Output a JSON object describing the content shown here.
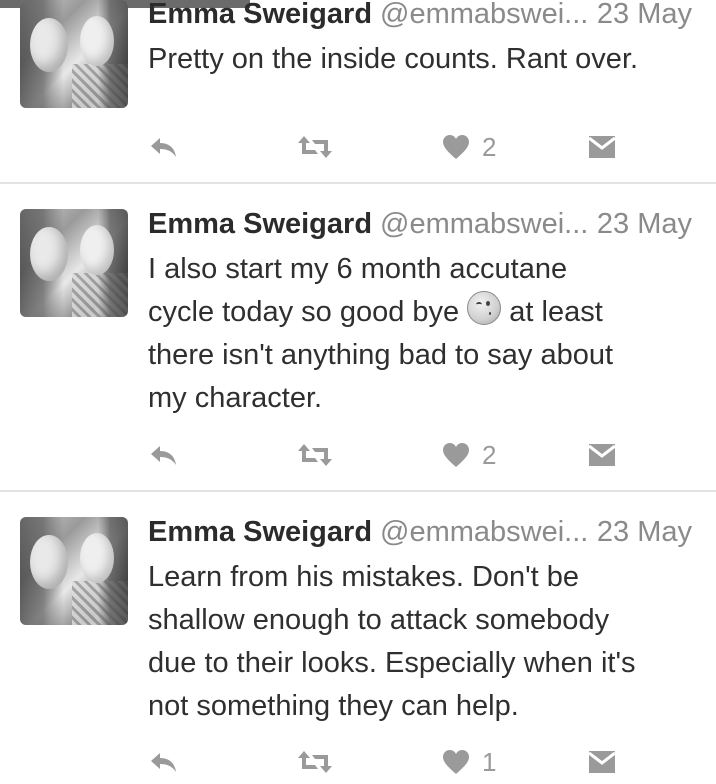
{
  "tweets": [
    {
      "name": "Emma Sweigard",
      "handle": "@emmabswei...",
      "date": "23 May",
      "lines": [
        "Pretty on the inside counts. Rant over."
      ],
      "likes": "2"
    },
    {
      "name": "Emma Sweigard",
      "handle": "@emmabswei...",
      "date": "23 May",
      "lines": [
        "I also start my 6 month accutane",
        "cycle today so good bye",
        "at least",
        "there isn't anything bad to say about",
        "my character."
      ],
      "emoji": "kissing-face-emoji",
      "likes": "2"
    },
    {
      "name": "Emma Sweigard",
      "handle": "@emmabswei...",
      "date": "23 May",
      "lines": [
        "Learn from his mistakes. Don't be",
        "shallow enough to attack somebody",
        "due to their looks. Especially when it's",
        "not something they can help."
      ],
      "likes": "1"
    }
  ],
  "icons": {
    "reply": "reply-icon",
    "retweet": "retweet-icon",
    "like": "heart-icon",
    "message": "direct-message-icon"
  },
  "colors": {
    "text": "#2b2b2b",
    "muted": "#8a8a8a",
    "icon": "#9a9a9a",
    "divider": "#e3e3e3"
  }
}
